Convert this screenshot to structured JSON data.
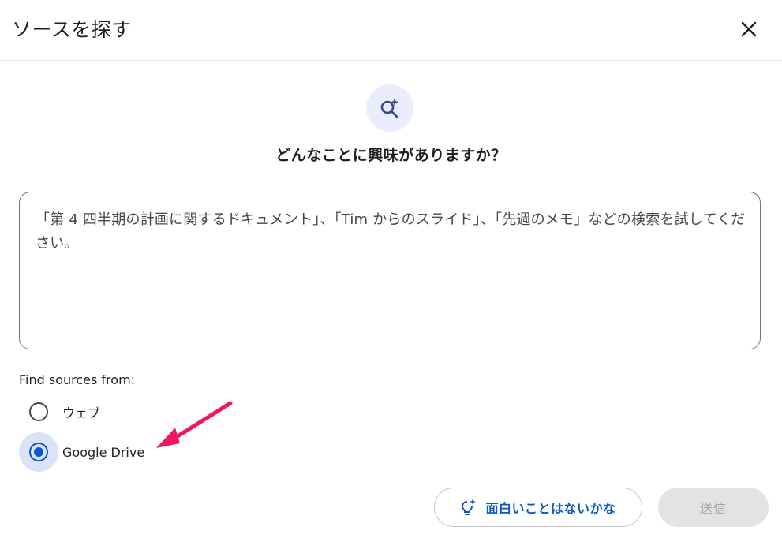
{
  "dialog": {
    "title": "ソースを探す",
    "close_icon": "close-icon"
  },
  "hero": {
    "icon": "search-spark-icon",
    "question": "どんなことに興味がありますか？"
  },
  "query": {
    "placeholder": "「第 4 四半期の計画に関するドキュメント」、「Tim からのスライド」、「先週のメモ」などの検索を試してください。",
    "value": ""
  },
  "sources": {
    "label": "Find sources from:",
    "options": [
      {
        "label": "ウェブ",
        "selected": false
      },
      {
        "label": "Google Drive",
        "selected": true
      }
    ]
  },
  "annotation": {
    "arrow_color": "#f0185c"
  },
  "actions": {
    "discover_icon": "lightbulb-spark-icon",
    "discover_label": "面白いことはないかな",
    "submit_label": "送信"
  },
  "colors": {
    "accent": "#0b57d0",
    "selected_halo": "#dbe4f7",
    "hero_bg": "#eaeefc",
    "disabled_bg": "#e3e3e3"
  }
}
